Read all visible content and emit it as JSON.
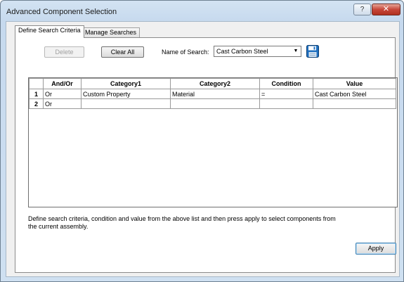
{
  "window": {
    "title": "Advanced Component Selection",
    "help_glyph": "?",
    "close_glyph": "✕"
  },
  "tabs": [
    {
      "label": "Define Search Criteria",
      "active": true
    },
    {
      "label": "Manage Searches",
      "active": false
    }
  ],
  "toolbar": {
    "delete_label": "Delete",
    "clear_all_label": "Clear All",
    "name_of_search_label": "Name of Search:",
    "name_of_search_value": "Cast Carbon Steel"
  },
  "grid": {
    "columns": [
      "",
      "And/Or",
      "Category1",
      "Category2",
      "Condition",
      "Value"
    ],
    "rows": [
      {
        "num": "1",
        "andor": "Or",
        "category1": "Custom Property",
        "category2": "Material",
        "condition": "=",
        "value": "Cast Carbon Steel"
      },
      {
        "num": "2",
        "andor": "Or",
        "category1": "",
        "category2": "",
        "condition": "",
        "value": ""
      }
    ]
  },
  "description": "Define search criteria, condition and value from the above list and then press apply to select components from the current assembly.",
  "apply_label": "Apply",
  "colors": {
    "title_bar": "#c6d9ee",
    "close_button": "#c7473a",
    "save_icon": "#1f6fbf"
  },
  "icons": {
    "save": "floppy-disk-icon",
    "dropdown": "chevron-down-icon"
  }
}
